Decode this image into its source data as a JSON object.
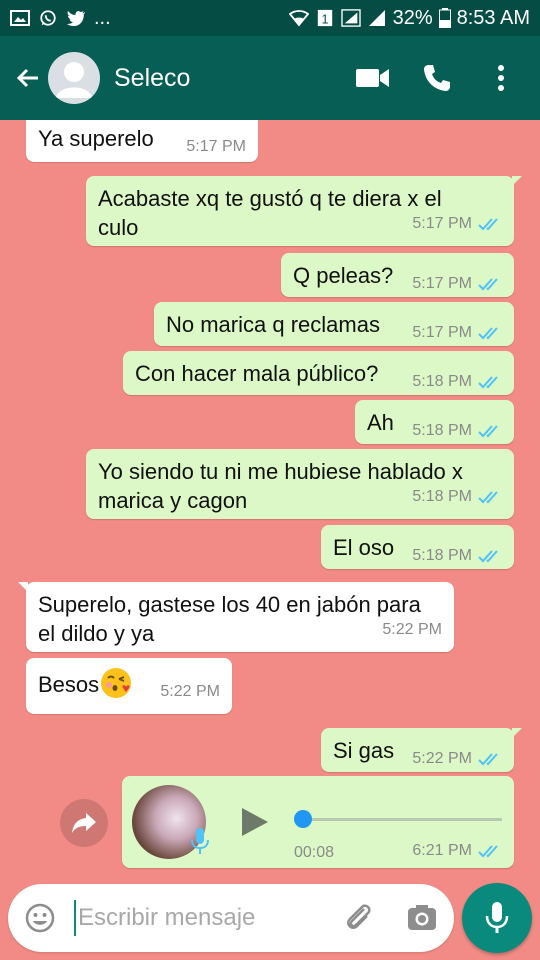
{
  "status_bar": {
    "battery": "32%",
    "clock": "8:53 AM",
    "more": "..."
  },
  "header": {
    "contact_name": "Seleco",
    "icons": [
      "back-arrow-icon",
      "avatar-placeholder-icon",
      "video-call-icon",
      "phone-call-icon",
      "more-vert-icon"
    ]
  },
  "colors": {
    "header": "#075e54",
    "status_bar": "#054d44",
    "chat_bg": "#f28b85",
    "incoming": "#ffffff",
    "outgoing": "#dcf8c6",
    "read_ticks": "#4fc3f7",
    "fab": "#0a8a7d"
  },
  "messages": [
    {
      "dir": "in",
      "text": "Ya superelo",
      "time": "5:17 PM"
    },
    {
      "dir": "out",
      "text": "Acabaste xq te gustó q te diera x el culo",
      "time": "5:17 PM"
    },
    {
      "dir": "out",
      "text": "Q peleas?",
      "time": "5:17 PM"
    },
    {
      "dir": "out",
      "text": "No marica q reclamas",
      "time": "5:17 PM"
    },
    {
      "dir": "out",
      "text": "Con hacer mala público?",
      "time": "5:18 PM"
    },
    {
      "dir": "out",
      "text": "Ah",
      "time": "5:18 PM"
    },
    {
      "dir": "out",
      "text": "Yo siendo tu ni me hubiese hablado x marica y cagon",
      "time": "5:18 PM"
    },
    {
      "dir": "out",
      "text": "El oso",
      "time": "5:18 PM"
    },
    {
      "dir": "in",
      "text": "Superelo, gastese los 40 en jabón para el dildo y ya",
      "time": "5:22 PM"
    },
    {
      "dir": "in",
      "text": "Besos",
      "time": "5:22 PM"
    },
    {
      "dir": "out",
      "text": "Si gas",
      "time": "5:22 PM"
    }
  ],
  "voice_note": {
    "duration": "00:08",
    "time": "6:21 PM",
    "progress": 0.0
  },
  "composer": {
    "placeholder": "Escribir mensaje"
  }
}
